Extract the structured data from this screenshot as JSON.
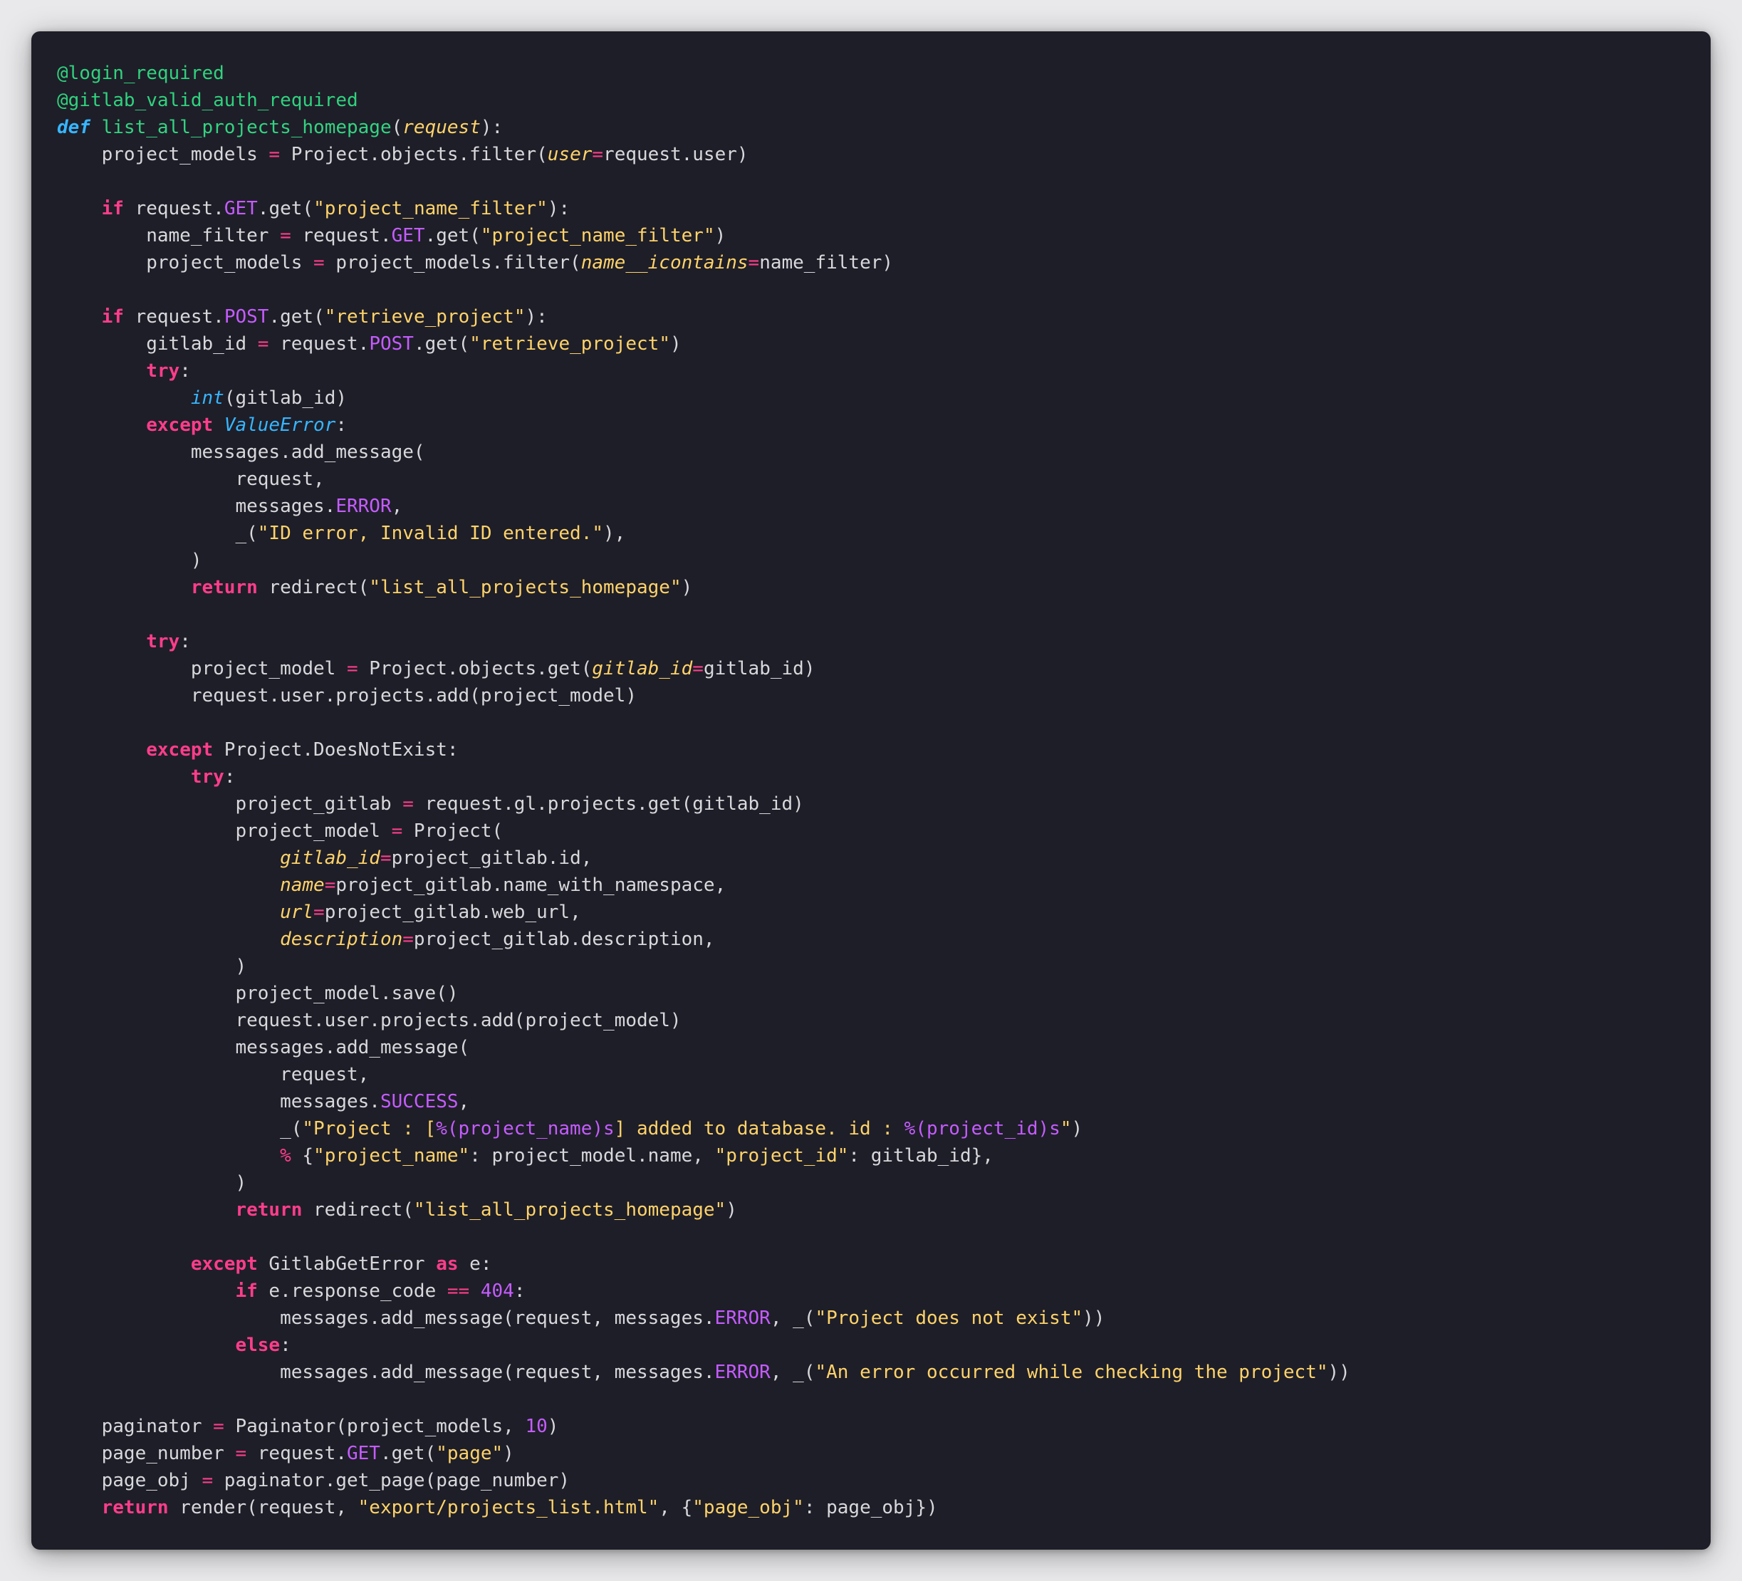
{
  "editor": {
    "lines": [
      [
        {
          "t": "@login_required",
          "c": "decorator"
        }
      ],
      [
        {
          "t": "@gitlab_valid_auth_required",
          "c": "decorator"
        }
      ],
      [
        {
          "t": "def",
          "c": "def"
        },
        {
          "t": " ",
          "c": "default"
        },
        {
          "t": "list_all_projects_homepage",
          "c": "func"
        },
        {
          "t": "(",
          "c": "default"
        },
        {
          "t": "request",
          "c": "param"
        },
        {
          "t": "):",
          "c": "default"
        }
      ],
      [
        {
          "t": "    project_models ",
          "c": "default"
        },
        {
          "t": "=",
          "c": "op"
        },
        {
          "t": " Project.objects.filter(",
          "c": "default"
        },
        {
          "t": "user",
          "c": "param"
        },
        {
          "t": "=",
          "c": "op"
        },
        {
          "t": "request.user)",
          "c": "default"
        }
      ],
      [],
      [
        {
          "t": "    ",
          "c": "default"
        },
        {
          "t": "if",
          "c": "kw"
        },
        {
          "t": " request.",
          "c": "default"
        },
        {
          "t": "GET",
          "c": "const"
        },
        {
          "t": ".get(",
          "c": "default"
        },
        {
          "t": "\"project_name_filter\"",
          "c": "string"
        },
        {
          "t": "):",
          "c": "default"
        }
      ],
      [
        {
          "t": "        name_filter ",
          "c": "default"
        },
        {
          "t": "=",
          "c": "op"
        },
        {
          "t": " request.",
          "c": "default"
        },
        {
          "t": "GET",
          "c": "const"
        },
        {
          "t": ".get(",
          "c": "default"
        },
        {
          "t": "\"project_name_filter\"",
          "c": "string"
        },
        {
          "t": ")",
          "c": "default"
        }
      ],
      [
        {
          "t": "        project_models ",
          "c": "default"
        },
        {
          "t": "=",
          "c": "op"
        },
        {
          "t": " project_models.filter(",
          "c": "default"
        },
        {
          "t": "name__icontains",
          "c": "param"
        },
        {
          "t": "=",
          "c": "op"
        },
        {
          "t": "name_filter)",
          "c": "default"
        }
      ],
      [],
      [
        {
          "t": "    ",
          "c": "default"
        },
        {
          "t": "if",
          "c": "kw"
        },
        {
          "t": " request.",
          "c": "default"
        },
        {
          "t": "POST",
          "c": "const"
        },
        {
          "t": ".get(",
          "c": "default"
        },
        {
          "t": "\"retrieve_project\"",
          "c": "string"
        },
        {
          "t": "):",
          "c": "default"
        }
      ],
      [
        {
          "t": "        gitlab_id ",
          "c": "default"
        },
        {
          "t": "=",
          "c": "op"
        },
        {
          "t": " request.",
          "c": "default"
        },
        {
          "t": "POST",
          "c": "const"
        },
        {
          "t": ".get(",
          "c": "default"
        },
        {
          "t": "\"retrieve_project\"",
          "c": "string"
        },
        {
          "t": ")",
          "c": "default"
        }
      ],
      [
        {
          "t": "        ",
          "c": "default"
        },
        {
          "t": "try",
          "c": "kw"
        },
        {
          "t": ":",
          "c": "default"
        }
      ],
      [
        {
          "t": "            ",
          "c": "default"
        },
        {
          "t": "int",
          "c": "builtin"
        },
        {
          "t": "(gitlab_id)",
          "c": "default"
        }
      ],
      [
        {
          "t": "        ",
          "c": "default"
        },
        {
          "t": "except",
          "c": "kw"
        },
        {
          "t": " ",
          "c": "default"
        },
        {
          "t": "ValueError",
          "c": "builtin"
        },
        {
          "t": ":",
          "c": "default"
        }
      ],
      [
        {
          "t": "            messages.add_message(",
          "c": "default"
        }
      ],
      [
        {
          "t": "                request,",
          "c": "default"
        }
      ],
      [
        {
          "t": "                messages.",
          "c": "default"
        },
        {
          "t": "ERROR",
          "c": "const"
        },
        {
          "t": ",",
          "c": "default"
        }
      ],
      [
        {
          "t": "                _(",
          "c": "default"
        },
        {
          "t": "\"ID error, Invalid ID entered.\"",
          "c": "string"
        },
        {
          "t": "),",
          "c": "default"
        }
      ],
      [
        {
          "t": "            )",
          "c": "default"
        }
      ],
      [
        {
          "t": "            ",
          "c": "default"
        },
        {
          "t": "return",
          "c": "kw"
        },
        {
          "t": " redirect(",
          "c": "default"
        },
        {
          "t": "\"list_all_projects_homepage\"",
          "c": "string"
        },
        {
          "t": ")",
          "c": "default"
        }
      ],
      [],
      [
        {
          "t": "        ",
          "c": "default"
        },
        {
          "t": "try",
          "c": "kw"
        },
        {
          "t": ":",
          "c": "default"
        }
      ],
      [
        {
          "t": "            project_model ",
          "c": "default"
        },
        {
          "t": "=",
          "c": "op"
        },
        {
          "t": " Project.objects.get(",
          "c": "default"
        },
        {
          "t": "gitlab_id",
          "c": "param"
        },
        {
          "t": "=",
          "c": "op"
        },
        {
          "t": "gitlab_id)",
          "c": "default"
        }
      ],
      [
        {
          "t": "            request.user.projects.add(project_model)",
          "c": "default"
        }
      ],
      [],
      [
        {
          "t": "        ",
          "c": "default"
        },
        {
          "t": "except",
          "c": "kw"
        },
        {
          "t": " Project.DoesNotExist:",
          "c": "default"
        }
      ],
      [
        {
          "t": "            ",
          "c": "default"
        },
        {
          "t": "try",
          "c": "kw"
        },
        {
          "t": ":",
          "c": "default"
        }
      ],
      [
        {
          "t": "                project_gitlab ",
          "c": "default"
        },
        {
          "t": "=",
          "c": "op"
        },
        {
          "t": " request.gl.projects.get(gitlab_id)",
          "c": "default"
        }
      ],
      [
        {
          "t": "                project_model ",
          "c": "default"
        },
        {
          "t": "=",
          "c": "op"
        },
        {
          "t": " Project(",
          "c": "default"
        }
      ],
      [
        {
          "t": "                    ",
          "c": "default"
        },
        {
          "t": "gitlab_id",
          "c": "param"
        },
        {
          "t": "=",
          "c": "op"
        },
        {
          "t": "project_gitlab.id,",
          "c": "default"
        }
      ],
      [
        {
          "t": "                    ",
          "c": "default"
        },
        {
          "t": "name",
          "c": "param"
        },
        {
          "t": "=",
          "c": "op"
        },
        {
          "t": "project_gitlab.name_with_namespace,",
          "c": "default"
        }
      ],
      [
        {
          "t": "                    ",
          "c": "default"
        },
        {
          "t": "url",
          "c": "param"
        },
        {
          "t": "=",
          "c": "op"
        },
        {
          "t": "project_gitlab.web_url,",
          "c": "default"
        }
      ],
      [
        {
          "t": "                    ",
          "c": "default"
        },
        {
          "t": "description",
          "c": "param"
        },
        {
          "t": "=",
          "c": "op"
        },
        {
          "t": "project_gitlab.description,",
          "c": "default"
        }
      ],
      [
        {
          "t": "                )",
          "c": "default"
        }
      ],
      [
        {
          "t": "                project_model.save()",
          "c": "default"
        }
      ],
      [
        {
          "t": "                request.user.projects.add(project_model)",
          "c": "default"
        }
      ],
      [
        {
          "t": "                messages.add_message(",
          "c": "default"
        }
      ],
      [
        {
          "t": "                    request,",
          "c": "default"
        }
      ],
      [
        {
          "t": "                    messages.",
          "c": "default"
        },
        {
          "t": "SUCCESS",
          "c": "const"
        },
        {
          "t": ",",
          "c": "default"
        }
      ],
      [
        {
          "t": "                    _(",
          "c": "default"
        },
        {
          "t": "\"Project : [",
          "c": "string"
        },
        {
          "t": "%(project_name)s",
          "c": "const"
        },
        {
          "t": "] added to database. id : ",
          "c": "string"
        },
        {
          "t": "%(project_id)s",
          "c": "const"
        },
        {
          "t": "\"",
          "c": "string"
        },
        {
          "t": ")",
          "c": "default"
        }
      ],
      [
        {
          "t": "                    ",
          "c": "default"
        },
        {
          "t": "%",
          "c": "op"
        },
        {
          "t": " {",
          "c": "default"
        },
        {
          "t": "\"project_name\"",
          "c": "string"
        },
        {
          "t": ": project_model.name, ",
          "c": "default"
        },
        {
          "t": "\"project_id\"",
          "c": "string"
        },
        {
          "t": ": gitlab_id},",
          "c": "default"
        }
      ],
      [
        {
          "t": "                )",
          "c": "default"
        }
      ],
      [
        {
          "t": "                ",
          "c": "default"
        },
        {
          "t": "return",
          "c": "kw"
        },
        {
          "t": " redirect(",
          "c": "default"
        },
        {
          "t": "\"list_all_projects_homepage\"",
          "c": "string"
        },
        {
          "t": ")",
          "c": "default"
        }
      ],
      [],
      [
        {
          "t": "            ",
          "c": "default"
        },
        {
          "t": "except",
          "c": "kw"
        },
        {
          "t": " GitlabGetError ",
          "c": "default"
        },
        {
          "t": "as",
          "c": "kw"
        },
        {
          "t": " e:",
          "c": "default"
        }
      ],
      [
        {
          "t": "                ",
          "c": "default"
        },
        {
          "t": "if",
          "c": "kw"
        },
        {
          "t": " e.response_code ",
          "c": "default"
        },
        {
          "t": "==",
          "c": "op"
        },
        {
          "t": " ",
          "c": "default"
        },
        {
          "t": "404",
          "c": "number"
        },
        {
          "t": ":",
          "c": "default"
        }
      ],
      [
        {
          "t": "                    messages.add_message(request, messages.",
          "c": "default"
        },
        {
          "t": "ERROR",
          "c": "const"
        },
        {
          "t": ", _(",
          "c": "default"
        },
        {
          "t": "\"Project does not exist\"",
          "c": "string"
        },
        {
          "t": "))",
          "c": "default"
        }
      ],
      [
        {
          "t": "                ",
          "c": "default"
        },
        {
          "t": "else",
          "c": "kw"
        },
        {
          "t": ":",
          "c": "default"
        }
      ],
      [
        {
          "t": "                    messages.add_message(request, messages.",
          "c": "default"
        },
        {
          "t": "ERROR",
          "c": "const"
        },
        {
          "t": ", _(",
          "c": "default"
        },
        {
          "t": "\"An error occurred while checking the project\"",
          "c": "string"
        },
        {
          "t": "))",
          "c": "default"
        }
      ],
      [],
      [
        {
          "t": "    paginator ",
          "c": "default"
        },
        {
          "t": "=",
          "c": "op"
        },
        {
          "t": " Paginator(project_models, ",
          "c": "default"
        },
        {
          "t": "10",
          "c": "number"
        },
        {
          "t": ")",
          "c": "default"
        }
      ],
      [
        {
          "t": "    page_number ",
          "c": "default"
        },
        {
          "t": "=",
          "c": "op"
        },
        {
          "t": " request.",
          "c": "default"
        },
        {
          "t": "GET",
          "c": "const"
        },
        {
          "t": ".get(",
          "c": "default"
        },
        {
          "t": "\"page\"",
          "c": "string"
        },
        {
          "t": ")",
          "c": "default"
        }
      ],
      [
        {
          "t": "    page_obj ",
          "c": "default"
        },
        {
          "t": "=",
          "c": "op"
        },
        {
          "t": " paginator.get_page(page_number)",
          "c": "default"
        }
      ],
      [
        {
          "t": "    ",
          "c": "default"
        },
        {
          "t": "return",
          "c": "kw"
        },
        {
          "t": " render(request, ",
          "c": "default"
        },
        {
          "t": "\"export/projects_list.html\"",
          "c": "string"
        },
        {
          "t": ", {",
          "c": "default"
        },
        {
          "t": "\"page_obj\"",
          "c": "string"
        },
        {
          "t": ": page_obj})",
          "c": "default"
        }
      ]
    ]
  }
}
